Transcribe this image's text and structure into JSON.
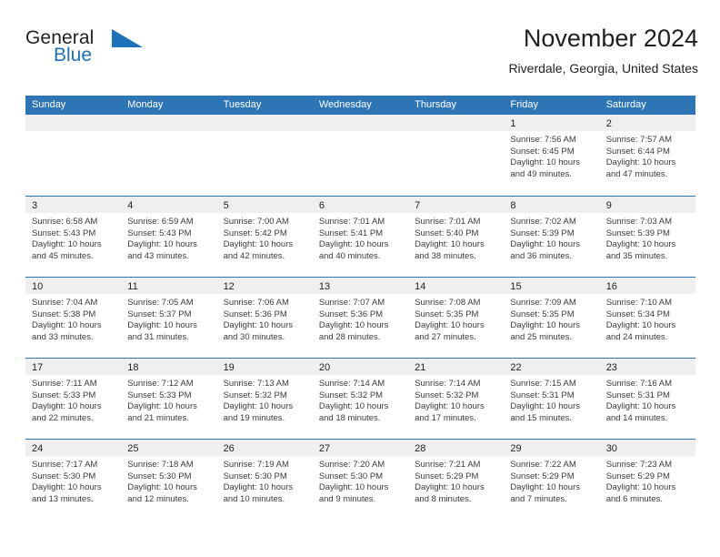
{
  "brand": {
    "name_part1": "General",
    "name_part2": "Blue",
    "logo_icon": "blue-triangle-icon",
    "color_dark": "#231f20",
    "color_blue": "#2072b8"
  },
  "header": {
    "title": "November 2024",
    "subtitle": "Riverdale, Georgia, United States"
  },
  "theme": {
    "header_blue": "#2E75B6",
    "day_band_gray": "#EFEFEF",
    "text_color": "#231F20"
  },
  "calendar": {
    "weekday_headers": [
      "Sunday",
      "Monday",
      "Tuesday",
      "Wednesday",
      "Thursday",
      "Friday",
      "Saturday"
    ],
    "labels": {
      "sunrise": "Sunrise:",
      "sunset": "Sunset:",
      "daylight": "Daylight:"
    },
    "weeks": [
      [
        {
          "day": "",
          "empty": true
        },
        {
          "day": "",
          "empty": true
        },
        {
          "day": "",
          "empty": true
        },
        {
          "day": "",
          "empty": true
        },
        {
          "day": "",
          "empty": true
        },
        {
          "day": "1",
          "sunrise": "Sunrise: 7:56 AM",
          "sunset": "Sunset: 6:45 PM",
          "daylight_l1": "Daylight: 10 hours",
          "daylight_l2": "and 49 minutes."
        },
        {
          "day": "2",
          "sunrise": "Sunrise: 7:57 AM",
          "sunset": "Sunset: 6:44 PM",
          "daylight_l1": "Daylight: 10 hours",
          "daylight_l2": "and 47 minutes."
        }
      ],
      [
        {
          "day": "3",
          "sunrise": "Sunrise: 6:58 AM",
          "sunset": "Sunset: 5:43 PM",
          "daylight_l1": "Daylight: 10 hours",
          "daylight_l2": "and 45 minutes."
        },
        {
          "day": "4",
          "sunrise": "Sunrise: 6:59 AM",
          "sunset": "Sunset: 5:43 PM",
          "daylight_l1": "Daylight: 10 hours",
          "daylight_l2": "and 43 minutes."
        },
        {
          "day": "5",
          "sunrise": "Sunrise: 7:00 AM",
          "sunset": "Sunset: 5:42 PM",
          "daylight_l1": "Daylight: 10 hours",
          "daylight_l2": "and 42 minutes."
        },
        {
          "day": "6",
          "sunrise": "Sunrise: 7:01 AM",
          "sunset": "Sunset: 5:41 PM",
          "daylight_l1": "Daylight: 10 hours",
          "daylight_l2": "and 40 minutes."
        },
        {
          "day": "7",
          "sunrise": "Sunrise: 7:01 AM",
          "sunset": "Sunset: 5:40 PM",
          "daylight_l1": "Daylight: 10 hours",
          "daylight_l2": "and 38 minutes."
        },
        {
          "day": "8",
          "sunrise": "Sunrise: 7:02 AM",
          "sunset": "Sunset: 5:39 PM",
          "daylight_l1": "Daylight: 10 hours",
          "daylight_l2": "and 36 minutes."
        },
        {
          "day": "9",
          "sunrise": "Sunrise: 7:03 AM",
          "sunset": "Sunset: 5:39 PM",
          "daylight_l1": "Daylight: 10 hours",
          "daylight_l2": "and 35 minutes."
        }
      ],
      [
        {
          "day": "10",
          "sunrise": "Sunrise: 7:04 AM",
          "sunset": "Sunset: 5:38 PM",
          "daylight_l1": "Daylight: 10 hours",
          "daylight_l2": "and 33 minutes."
        },
        {
          "day": "11",
          "sunrise": "Sunrise: 7:05 AM",
          "sunset": "Sunset: 5:37 PM",
          "daylight_l1": "Daylight: 10 hours",
          "daylight_l2": "and 31 minutes."
        },
        {
          "day": "12",
          "sunrise": "Sunrise: 7:06 AM",
          "sunset": "Sunset: 5:36 PM",
          "daylight_l1": "Daylight: 10 hours",
          "daylight_l2": "and 30 minutes."
        },
        {
          "day": "13",
          "sunrise": "Sunrise: 7:07 AM",
          "sunset": "Sunset: 5:36 PM",
          "daylight_l1": "Daylight: 10 hours",
          "daylight_l2": "and 28 minutes."
        },
        {
          "day": "14",
          "sunrise": "Sunrise: 7:08 AM",
          "sunset": "Sunset: 5:35 PM",
          "daylight_l1": "Daylight: 10 hours",
          "daylight_l2": "and 27 minutes."
        },
        {
          "day": "15",
          "sunrise": "Sunrise: 7:09 AM",
          "sunset": "Sunset: 5:35 PM",
          "daylight_l1": "Daylight: 10 hours",
          "daylight_l2": "and 25 minutes."
        },
        {
          "day": "16",
          "sunrise": "Sunrise: 7:10 AM",
          "sunset": "Sunset: 5:34 PM",
          "daylight_l1": "Daylight: 10 hours",
          "daylight_l2": "and 24 minutes."
        }
      ],
      [
        {
          "day": "17",
          "sunrise": "Sunrise: 7:11 AM",
          "sunset": "Sunset: 5:33 PM",
          "daylight_l1": "Daylight: 10 hours",
          "daylight_l2": "and 22 minutes."
        },
        {
          "day": "18",
          "sunrise": "Sunrise: 7:12 AM",
          "sunset": "Sunset: 5:33 PM",
          "daylight_l1": "Daylight: 10 hours",
          "daylight_l2": "and 21 minutes."
        },
        {
          "day": "19",
          "sunrise": "Sunrise: 7:13 AM",
          "sunset": "Sunset: 5:32 PM",
          "daylight_l1": "Daylight: 10 hours",
          "daylight_l2": "and 19 minutes."
        },
        {
          "day": "20",
          "sunrise": "Sunrise: 7:14 AM",
          "sunset": "Sunset: 5:32 PM",
          "daylight_l1": "Daylight: 10 hours",
          "daylight_l2": "and 18 minutes."
        },
        {
          "day": "21",
          "sunrise": "Sunrise: 7:14 AM",
          "sunset": "Sunset: 5:32 PM",
          "daylight_l1": "Daylight: 10 hours",
          "daylight_l2": "and 17 minutes."
        },
        {
          "day": "22",
          "sunrise": "Sunrise: 7:15 AM",
          "sunset": "Sunset: 5:31 PM",
          "daylight_l1": "Daylight: 10 hours",
          "daylight_l2": "and 15 minutes."
        },
        {
          "day": "23",
          "sunrise": "Sunrise: 7:16 AM",
          "sunset": "Sunset: 5:31 PM",
          "daylight_l1": "Daylight: 10 hours",
          "daylight_l2": "and 14 minutes."
        }
      ],
      [
        {
          "day": "24",
          "sunrise": "Sunrise: 7:17 AM",
          "sunset": "Sunset: 5:30 PM",
          "daylight_l1": "Daylight: 10 hours",
          "daylight_l2": "and 13 minutes."
        },
        {
          "day": "25",
          "sunrise": "Sunrise: 7:18 AM",
          "sunset": "Sunset: 5:30 PM",
          "daylight_l1": "Daylight: 10 hours",
          "daylight_l2": "and 12 minutes."
        },
        {
          "day": "26",
          "sunrise": "Sunrise: 7:19 AM",
          "sunset": "Sunset: 5:30 PM",
          "daylight_l1": "Daylight: 10 hours",
          "daylight_l2": "and 10 minutes."
        },
        {
          "day": "27",
          "sunrise": "Sunrise: 7:20 AM",
          "sunset": "Sunset: 5:30 PM",
          "daylight_l1": "Daylight: 10 hours",
          "daylight_l2": "and 9 minutes."
        },
        {
          "day": "28",
          "sunrise": "Sunrise: 7:21 AM",
          "sunset": "Sunset: 5:29 PM",
          "daylight_l1": "Daylight: 10 hours",
          "daylight_l2": "and 8 minutes."
        },
        {
          "day": "29",
          "sunrise": "Sunrise: 7:22 AM",
          "sunset": "Sunset: 5:29 PM",
          "daylight_l1": "Daylight: 10 hours",
          "daylight_l2": "and 7 minutes."
        },
        {
          "day": "30",
          "sunrise": "Sunrise: 7:23 AM",
          "sunset": "Sunset: 5:29 PM",
          "daylight_l1": "Daylight: 10 hours",
          "daylight_l2": "and 6 minutes."
        }
      ]
    ]
  }
}
